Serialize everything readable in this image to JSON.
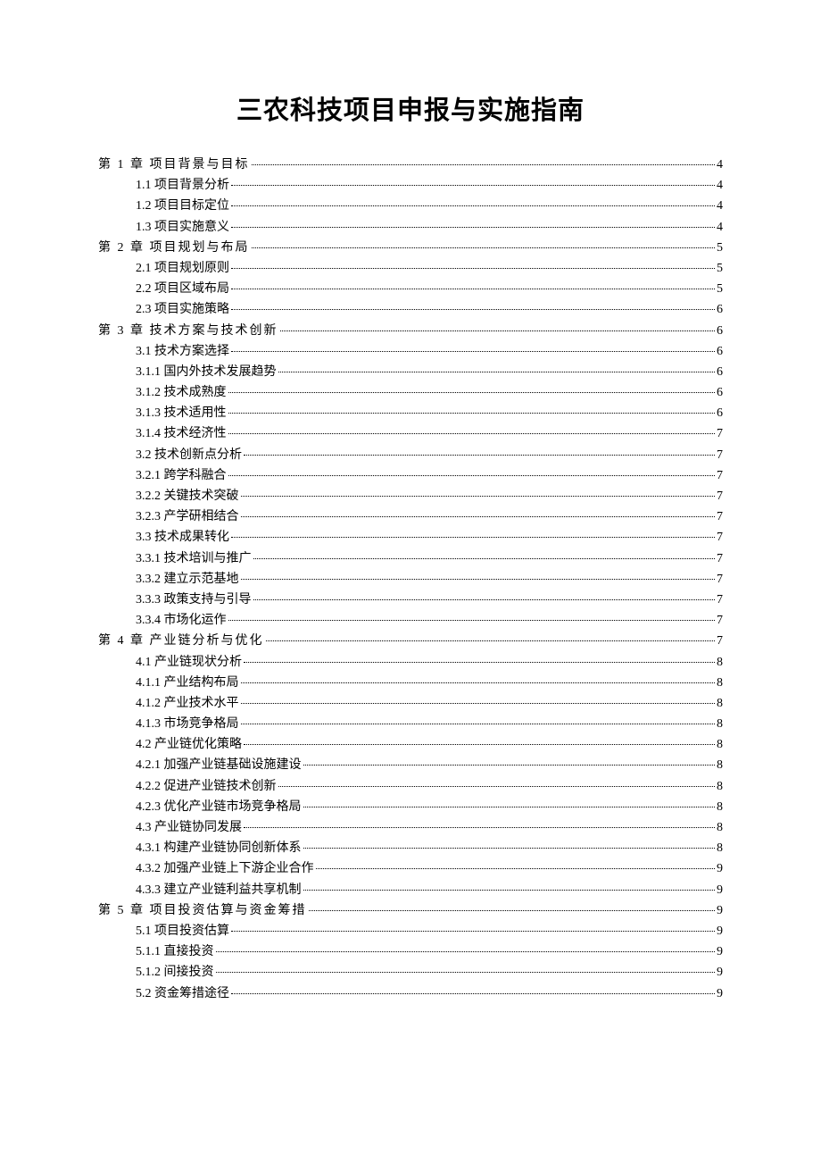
{
  "title": "三农科技项目申报与实施指南",
  "toc": [
    {
      "level": 0,
      "label": "第 1 章 项目背景与目标",
      "page": "4",
      "chapter": true
    },
    {
      "level": 1,
      "label": "1.1 项目背景分析",
      "page": "4"
    },
    {
      "level": 1,
      "label": "1.2 项目目标定位",
      "page": "4"
    },
    {
      "level": 1,
      "label": "1.3 项目实施意义",
      "page": "4"
    },
    {
      "level": 0,
      "label": "第 2 章 项目规划与布局",
      "page": "5",
      "chapter": true
    },
    {
      "level": 1,
      "label": "2.1 项目规划原则",
      "page": "5"
    },
    {
      "level": 1,
      "label": "2.2 项目区域布局",
      "page": "5"
    },
    {
      "level": 1,
      "label": "2.3 项目实施策略",
      "page": "6"
    },
    {
      "level": 0,
      "label": "第 3 章 技术方案与技术创新",
      "page": "6",
      "chapter": true
    },
    {
      "level": 1,
      "label": "3.1 技术方案选择",
      "page": "6"
    },
    {
      "level": 1,
      "label": "3.1.1 国内外技术发展趋势",
      "page": "6"
    },
    {
      "level": 1,
      "label": "3.1.2 技术成熟度",
      "page": "6"
    },
    {
      "level": 1,
      "label": "3.1.3 技术适用性",
      "page": "6"
    },
    {
      "level": 1,
      "label": "3.1.4 技术经济性",
      "page": "7"
    },
    {
      "level": 1,
      "label": "3.2 技术创新点分析",
      "page": "7"
    },
    {
      "level": 1,
      "label": "3.2.1 跨学科融合",
      "page": "7"
    },
    {
      "level": 1,
      "label": "3.2.2 关键技术突破",
      "page": "7"
    },
    {
      "level": 1,
      "label": "3.2.3 产学研相结合",
      "page": "7"
    },
    {
      "level": 1,
      "label": "3.3 技术成果转化",
      "page": "7"
    },
    {
      "level": 1,
      "label": "3.3.1 技术培训与推广",
      "page": "7"
    },
    {
      "level": 1,
      "label": "3.3.2 建立示范基地",
      "page": "7"
    },
    {
      "level": 1,
      "label": "3.3.3 政策支持与引导",
      "page": "7"
    },
    {
      "level": 1,
      "label": "3.3.4 市场化运作",
      "page": "7"
    },
    {
      "level": 0,
      "label": "第 4 章 产业链分析与优化",
      "page": "7",
      "chapter": true
    },
    {
      "level": 1,
      "label": "4.1 产业链现状分析",
      "page": "8"
    },
    {
      "level": 1,
      "label": "4.1.1 产业结构布局",
      "page": "8"
    },
    {
      "level": 1,
      "label": "4.1.2 产业技术水平",
      "page": "8"
    },
    {
      "level": 1,
      "label": "4.1.3 市场竞争格局",
      "page": "8"
    },
    {
      "level": 1,
      "label": "4.2 产业链优化策略",
      "page": "8"
    },
    {
      "level": 1,
      "label": "4.2.1 加强产业链基础设施建设",
      "page": "8"
    },
    {
      "level": 1,
      "label": "4.2.2 促进产业链技术创新",
      "page": "8"
    },
    {
      "level": 1,
      "label": "4.2.3 优化产业链市场竞争格局",
      "page": "8"
    },
    {
      "level": 1,
      "label": "4.3 产业链协同发展",
      "page": "8"
    },
    {
      "level": 1,
      "label": "4.3.1 构建产业链协同创新体系",
      "page": "8"
    },
    {
      "level": 1,
      "label": "4.3.2 加强产业链上下游企业合作",
      "page": "9"
    },
    {
      "level": 1,
      "label": "4.3.3 建立产业链利益共享机制",
      "page": "9"
    },
    {
      "level": 0,
      "label": "第 5 章 项目投资估算与资金筹措",
      "page": "9",
      "chapter": true
    },
    {
      "level": 1,
      "label": "5.1 项目投资估算",
      "page": "9"
    },
    {
      "level": 1,
      "label": "5.1.1 直接投资",
      "page": "9"
    },
    {
      "level": 1,
      "label": "5.1.2 间接投资",
      "page": "9"
    },
    {
      "level": 1,
      "label": "5.2 资金筹措途径",
      "page": "9"
    }
  ]
}
